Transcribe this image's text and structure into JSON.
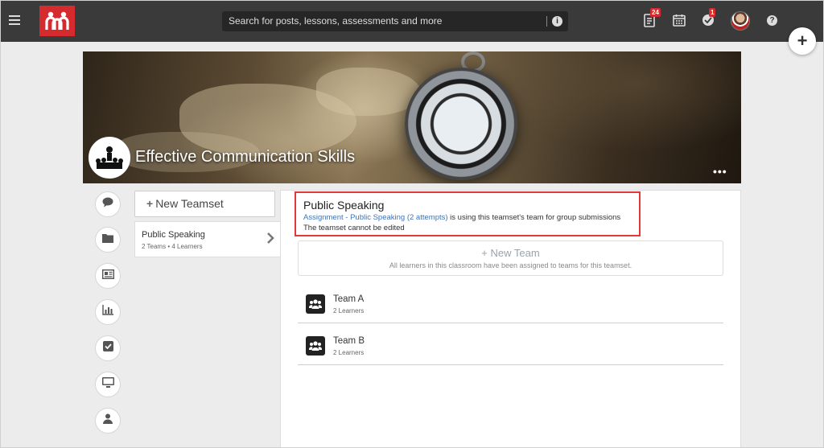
{
  "app": {
    "brand_color": "#d52b2e",
    "topbar_color": "#3a3a3a"
  },
  "topbar": {
    "search_placeholder": "Search for posts, lessons, assessments and more",
    "info_glyph": "i",
    "help_glyph": "?",
    "notifications": {
      "assignments_badge": "24",
      "grades_badge": "1"
    },
    "icons": [
      "menu-icon",
      "logo-icon",
      "info-icon",
      "assignments-icon",
      "calendar-icon",
      "grades-icon",
      "avatar",
      "help-icon"
    ]
  },
  "fab": {
    "glyph": "+"
  },
  "banner": {
    "title": "Effective Communication Skills",
    "more_glyph": "•••"
  },
  "rail": {
    "icons": [
      "chat-icon",
      "folder-icon",
      "newspaper-icon",
      "bar-chart-icon",
      "checkbox-icon",
      "monitor-icon",
      "person-icon"
    ]
  },
  "teamsets": {
    "new_button": "New Teamset",
    "items": [
      {
        "name": "Public Speaking",
        "meta": "2 Teams • 4 Learners"
      }
    ]
  },
  "notice": {
    "title": "Public Speaking",
    "link": "Assignment - Public Speaking (2 attempts)",
    "suffix": " is using this teamset's team for group submissions",
    "line2": "The teamset cannot be edited"
  },
  "new_team": {
    "label": "New Team",
    "note": "All learners in this classroom have been assigned to teams for this teamset."
  },
  "teams": [
    {
      "name": "Team A",
      "meta": "2 Learners"
    },
    {
      "name": "Team B",
      "meta": "2 Learners"
    }
  ]
}
